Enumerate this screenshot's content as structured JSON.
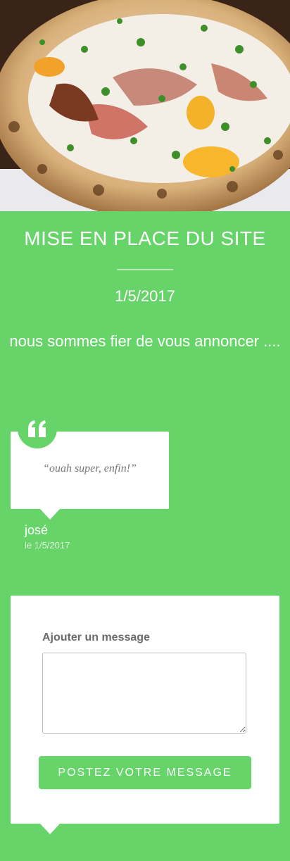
{
  "hero": {
    "image_description": "pizza-photo"
  },
  "post": {
    "title": "MISE EN PLACE DU SITE",
    "date": "1/5/2017",
    "body": "nous sommes fier de vous annoncer ...."
  },
  "comment": {
    "icon": "quote-icon",
    "text": "“ouah super, enfin!”",
    "author": "josé",
    "date": "le 1/5/2017"
  },
  "form": {
    "label": "Ajouter un message",
    "textarea_value": "",
    "submit_label": "POSTEZ VOTRE MESSAGE"
  },
  "colors": {
    "accent": "#66d468",
    "card": "#ffffff",
    "label": "#6a6a6a",
    "comment_text": "#777777"
  }
}
